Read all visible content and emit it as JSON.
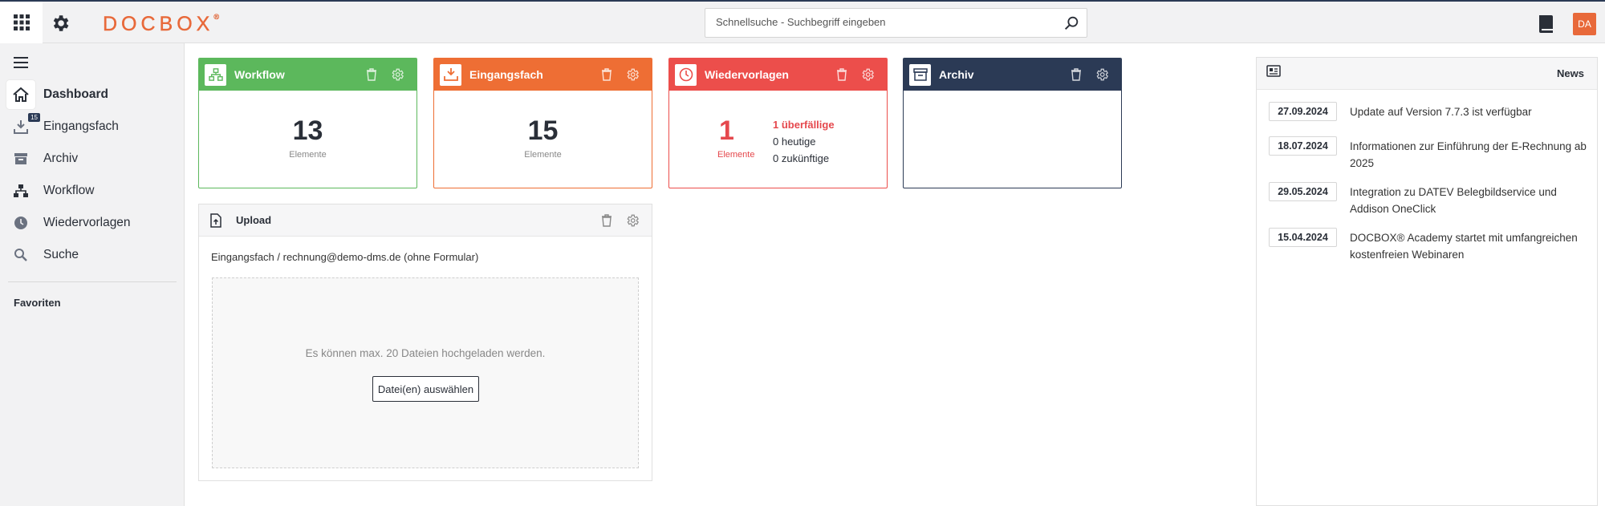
{
  "header": {
    "logo": "DOCBOX",
    "logo_mark": "®",
    "search_placeholder": "Schnellsuche - Suchbegriff eingeben",
    "avatar_initials": "DA"
  },
  "sidebar": {
    "items": [
      {
        "label": "Dashboard",
        "icon": "home-icon",
        "active": true
      },
      {
        "label": "Eingangsfach",
        "icon": "inbox-download-icon",
        "badge": "15"
      },
      {
        "label": "Archiv",
        "icon": "archive-box-icon"
      },
      {
        "label": "Workflow",
        "icon": "workflow-icon"
      },
      {
        "label": "Wiedervorlagen",
        "icon": "clock-icon"
      },
      {
        "label": "Suche",
        "icon": "search-icon"
      }
    ],
    "favorites_label": "Favoriten"
  },
  "cards": {
    "workflow": {
      "title": "Workflow",
      "count": "13",
      "sub": "Elemente",
      "color": "#5cb85c"
    },
    "inbox": {
      "title": "Eingangsfach",
      "count": "15",
      "sub": "Elemente",
      "color": "#ee6e34"
    },
    "resubmission": {
      "title": "Wiedervorlagen",
      "count": "1",
      "sub": "Elemente",
      "overdue": "1 überfällige",
      "today": "0 heutige",
      "future": "0 zukünftige",
      "color": "#ec4e4b"
    },
    "archive": {
      "title": "Archiv",
      "color": "#2b3a55"
    }
  },
  "upload": {
    "title": "Upload",
    "path": "Eingangsfach / rechnung@demo-dms.de (ohne Formular)",
    "hint": "Es können max. 20 Dateien hochgeladen werden.",
    "button": "Datei(en) auswählen"
  },
  "news": {
    "title": "News",
    "items": [
      {
        "date": "27.09.2024",
        "text": "Update auf Version 7.7.3 ist verfügbar"
      },
      {
        "date": "18.07.2024",
        "text": "Informationen zur Einführung der E-Rechnung ab 2025"
      },
      {
        "date": "29.05.2024",
        "text": "Integration zu DATEV Belegbildservice und Addison OneClick"
      },
      {
        "date": "15.04.2024",
        "text": "DOCBOX® Academy startet mit umfangreichen kostenfreien Webinaren"
      }
    ]
  }
}
